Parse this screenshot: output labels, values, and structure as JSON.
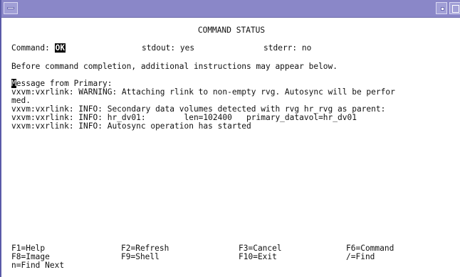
{
  "screen": {
    "title": "COMMAND STATUS",
    "command_label": "Command:",
    "command_value": "OK",
    "stdout_text": "stdout: yes",
    "stderr_text": "stderr: no",
    "note": "Before command completion, additional instructions may appear below.",
    "message_first_char": "M",
    "message_rest": "essage from Primary:",
    "output_lines": [
      "vxvm:vxrlink: WARNING: Attaching rlink to non-empty rvg. Autosync will be perfor",
      "med.",
      "vxvm:vxrlink: INFO: Secondary data volumes detected with rvg hr_rvg as parent:",
      "vxvm:vxrlink: INFO: hr_dv01:        len=102400   primary_datavol=hr_dv01",
      "vxvm:vxrlink: INFO: Autosync operation has started"
    ]
  },
  "function_keys": {
    "f1": "F1=Help",
    "f2": "F2=Refresh",
    "f3": "F3=Cancel",
    "f6": "F6=Command",
    "f8": "F8=Image",
    "f9": "F9=Shell",
    "f10": "F10=Exit",
    "find": "/=Find",
    "find_next": "n=Find Next"
  },
  "colors": {
    "titlebar": "#8a87c8",
    "background": "#ffffff",
    "text": "#111111"
  }
}
